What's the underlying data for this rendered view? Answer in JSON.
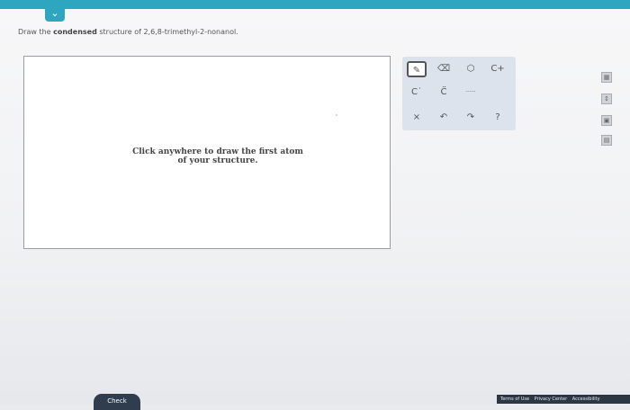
{
  "question": {
    "prefix": "Draw the ",
    "emphasis": "condensed",
    "suffix": " structure of 2,6,8-trimethyl-2-nonanol."
  },
  "canvas": {
    "hint_line1": "Click anywhere to draw the first atom",
    "hint_line2": "of your structure."
  },
  "toolbar": {
    "pencil": "✎",
    "eraser": "⌫",
    "ring": "⬡",
    "charge": "C+",
    "c_lone": "C˙",
    "c_pair": "C̈",
    "dots": "······",
    "clear": "×",
    "undo": "↶",
    "redo": "↷",
    "help": "?"
  },
  "side": {
    "b1": "▦",
    "b2": "↕",
    "b3": "▣",
    "b4": "▤"
  },
  "footer": {
    "check": "Check",
    "terms": "Terms of Use",
    "privacy": "Privacy Center",
    "accessibility": "Accessibility"
  },
  "colors": {
    "topbar": "#2ea6bf",
    "footer": "#2c3745",
    "toolbar_bg": "#dde3ec"
  }
}
